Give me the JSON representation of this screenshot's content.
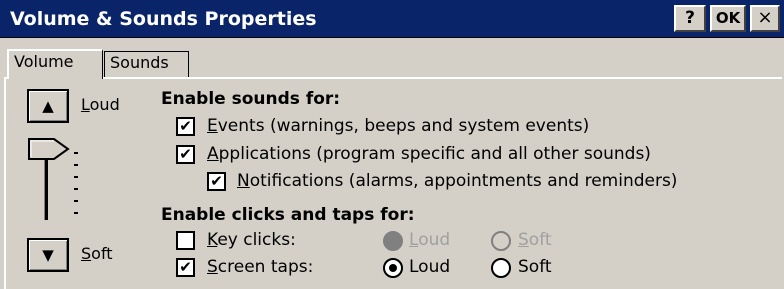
{
  "window": {
    "title": "Volume & Sounds Properties",
    "help_label": "?",
    "ok_label": "OK",
    "close_label": "×"
  },
  "tabs": [
    {
      "label": "Volume",
      "active": true
    },
    {
      "label": "Sounds",
      "active": false
    }
  ],
  "volume": {
    "up_icon": "▲",
    "down_icon": "▼",
    "loud_label_first": "L",
    "loud_label_rest": "oud",
    "soft_label_first": "S",
    "soft_label_rest": "oft",
    "level": 1.0
  },
  "enable_sounds": {
    "heading": "Enable sounds for:",
    "items": [
      {
        "first": "E",
        "rest": "vents (warnings, beeps and system events)",
        "checked": true
      },
      {
        "first": "A",
        "rest": "pplications (program specific and all other sounds)",
        "checked": true
      },
      {
        "first": "N",
        "rest": "otifications (alarms, appointments and reminders)",
        "checked": true
      }
    ]
  },
  "enable_clicks": {
    "heading": "Enable clicks and taps for:",
    "rows": [
      {
        "first": "K",
        "rest": "ey clicks:",
        "checked": false,
        "enabled": false,
        "loud_first": "L",
        "loud_rest": "oud",
        "soft_first": "S",
        "soft_rest": "oft",
        "selected": "Loud"
      },
      {
        "first": "S",
        "rest": "creen taps:",
        "checked": true,
        "enabled": true,
        "loud_first": "",
        "loud_rest": "Loud",
        "soft_first": "",
        "soft_rest": "Soft",
        "selected": "Loud"
      }
    ]
  },
  "check_mark": "✔"
}
